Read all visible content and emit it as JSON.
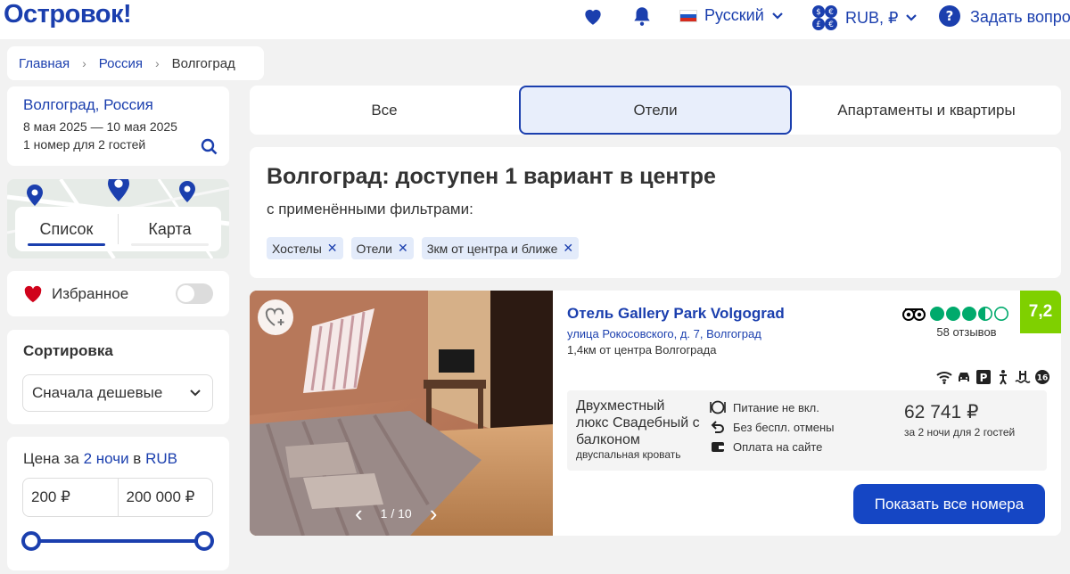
{
  "header": {
    "logo": "Островок!",
    "language": "Русский",
    "currency": "RUB, ₽",
    "help": "Задать вопро"
  },
  "breadcrumb": [
    "Главная",
    "Россия",
    "Волгоград"
  ],
  "search": {
    "destination": "Волгоград, Россия",
    "dates": "8 мая 2025 — 10 мая 2025",
    "guests": "1 номер для 2 гостей"
  },
  "view_toggle": {
    "list": "Список",
    "map": "Карта"
  },
  "favorites": {
    "label": "Избранное"
  },
  "sort": {
    "title": "Сортировка",
    "value": "Сначала дешевые"
  },
  "price_filter": {
    "prefix": "Цена за ",
    "nights": "2 ночи",
    "middle": " в ",
    "currency": "RUB",
    "min": "200 ₽",
    "max": "200 000 ₽"
  },
  "type_tabs": [
    "Все",
    "Отели",
    "Апартаменты и квартиры"
  ],
  "results": {
    "title": "Волгоград: доступен 1 вариант в центре",
    "subtitle": "с применёнными фильтрами:",
    "chips": [
      "Хостелы",
      "Отели",
      "3км от центра и ближе"
    ]
  },
  "hotel": {
    "name": "Отель Gallery Park Volgograd",
    "address": "улица Рокосовского, д. 7, Волгоград",
    "distance": "1,4км от центра Волгограда",
    "reviews": "58 отзывов",
    "score": "7,2",
    "photo_counter": "1 / 10",
    "room": {
      "name": "Двухместный люкс Свадебный с балконом",
      "bed": "двуспальная кровать",
      "features": [
        "Питание не вкл.",
        "Без беспл. отмены",
        "Оплата на сайте"
      ],
      "price": "62 741 ₽",
      "price_note": "за 2 ночи для 2 гостей"
    },
    "button": "Показать все номера"
  },
  "colors": {
    "brand": "#1b3fae",
    "button": "#1546c4",
    "score": "#7fd000",
    "tripadvisor": "#00aa6c",
    "heart": "#d0021b"
  }
}
